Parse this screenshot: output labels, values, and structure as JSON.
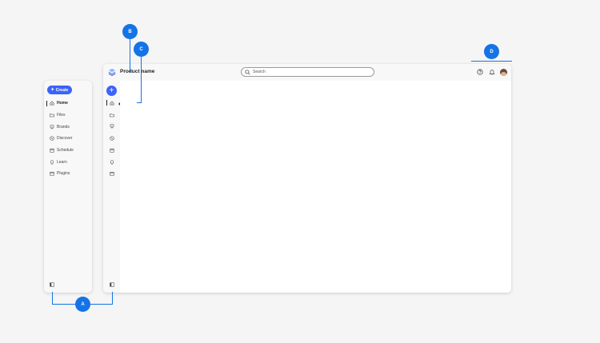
{
  "header": {
    "product_name": "Product name"
  },
  "search": {
    "placeholder": "Search"
  },
  "side_nav": {
    "create_label": "Create",
    "items": [
      {
        "label": "Home",
        "icon": "home-icon",
        "active": true
      },
      {
        "label": "Files",
        "icon": "folder-icon"
      },
      {
        "label": "Brands",
        "icon": "brand-icon"
      },
      {
        "label": "Discover",
        "icon": "compass-icon"
      },
      {
        "label": "Schedule",
        "icon": "calendar-icon"
      },
      {
        "label": "Learn",
        "icon": "lightbulb-icon"
      },
      {
        "label": "Plugins",
        "icon": "plugin-icon"
      }
    ]
  },
  "tooltip": {
    "text": "Home"
  },
  "annotations": {
    "a": "A",
    "b": "B",
    "c": "C",
    "d": "D"
  },
  "colors": {
    "accent": "#3b63fb",
    "annotation": "#1473e6",
    "tooltip_bg": "#2b2b2b"
  }
}
